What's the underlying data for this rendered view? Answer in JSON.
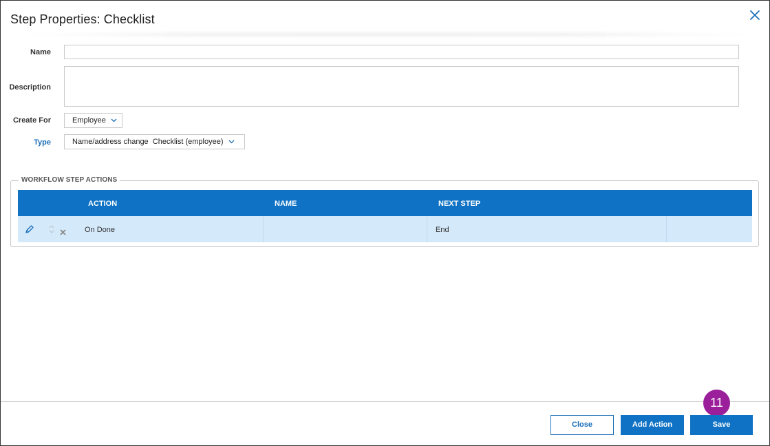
{
  "dialog": {
    "title": "Step Properties: Checklist"
  },
  "form": {
    "name_label": "Name",
    "name_value": "",
    "description_label": "Description",
    "description_value": "",
    "create_for_label": "Create For",
    "create_for_value": "Employee",
    "type_label": "Type",
    "type_value": "Name/address change  Checklist (employee)"
  },
  "actions_section": {
    "legend": "WORKFLOW STEP ACTIONS",
    "columns": [
      "ACTION",
      "NAME",
      "NEXT STEP"
    ],
    "rows": [
      {
        "action": "On Done",
        "name": "",
        "next_step": "End"
      }
    ]
  },
  "footer": {
    "close_label": "Close",
    "add_action_label": "Add Action",
    "save_label": "Save"
  },
  "annotation": {
    "step_number": "11"
  },
  "colors": {
    "primary": "#0f72c4",
    "row_selected": "#d4e9fa",
    "badge": "#9b1f9b"
  },
  "icons": {
    "close": "close-icon",
    "dropdown": "chevron-down-icon",
    "edit": "pencil-icon",
    "reorder": "sort-arrows-icon",
    "delete": "delete-x-icon"
  }
}
